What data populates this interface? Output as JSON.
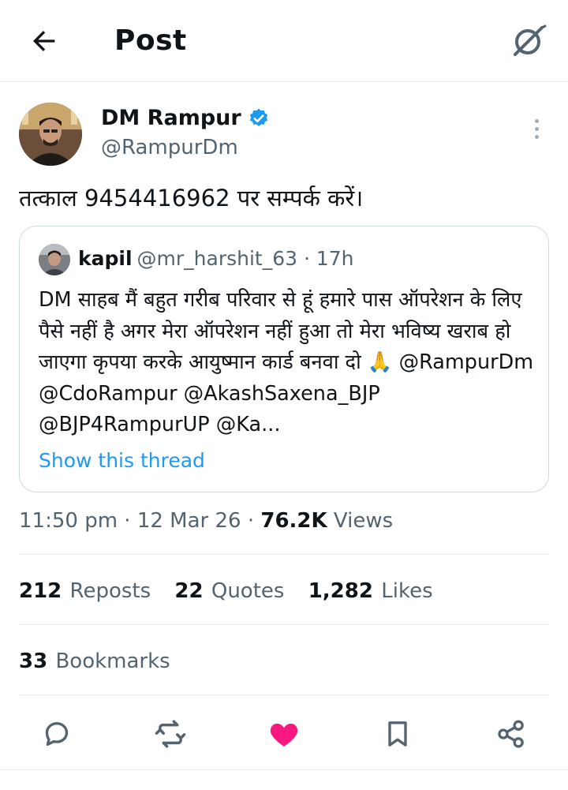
{
  "header": {
    "title": "Post"
  },
  "post": {
    "author_name": "DM Rampur",
    "author_handle": "@RampurDm",
    "text": "तत्काल 9454416962 पर सम्पर्क करें।",
    "timestamp": "11:50 pm · 12 Mar 26 · ",
    "views_count": "76.2K",
    "views_label": " Views"
  },
  "quote": {
    "name": "kapil",
    "handle_time": "@mr_harshit_63 · 17h",
    "text": "DM साहब मैं बहुत गरीब परिवार से हूं हमारे पास ऑपरेशन के लिए पैसे नहीं है अगर मेरा ऑपरेशन नहीं हुआ तो मेरा भविष्य खराब हो जाएगा कृपया करके आयुष्मान कार्ड बनवा दो 🙏 @RampurDm @CdoRampur @AkashSaxena_BJP @BJP4RampurUP @Ka...",
    "show_thread": "Show this thread"
  },
  "stats": {
    "reposts_count": "212",
    "reposts_label": "Reposts",
    "quotes_count": "22",
    "quotes_label": "Quotes",
    "likes_count": "1,282",
    "likes_label": "Likes",
    "bookmarks_count": "33",
    "bookmarks_label": "Bookmarks"
  },
  "actions": {
    "reply": "reply-icon",
    "repost": "repost-icon",
    "like": "heart-filled-icon",
    "bookmark": "bookmark-icon",
    "share": "share-icon"
  },
  "colors": {
    "accent": "#1d9bf0",
    "like": "#f91880",
    "secondary_text": "#536471",
    "verified": "#1d9bf0"
  }
}
